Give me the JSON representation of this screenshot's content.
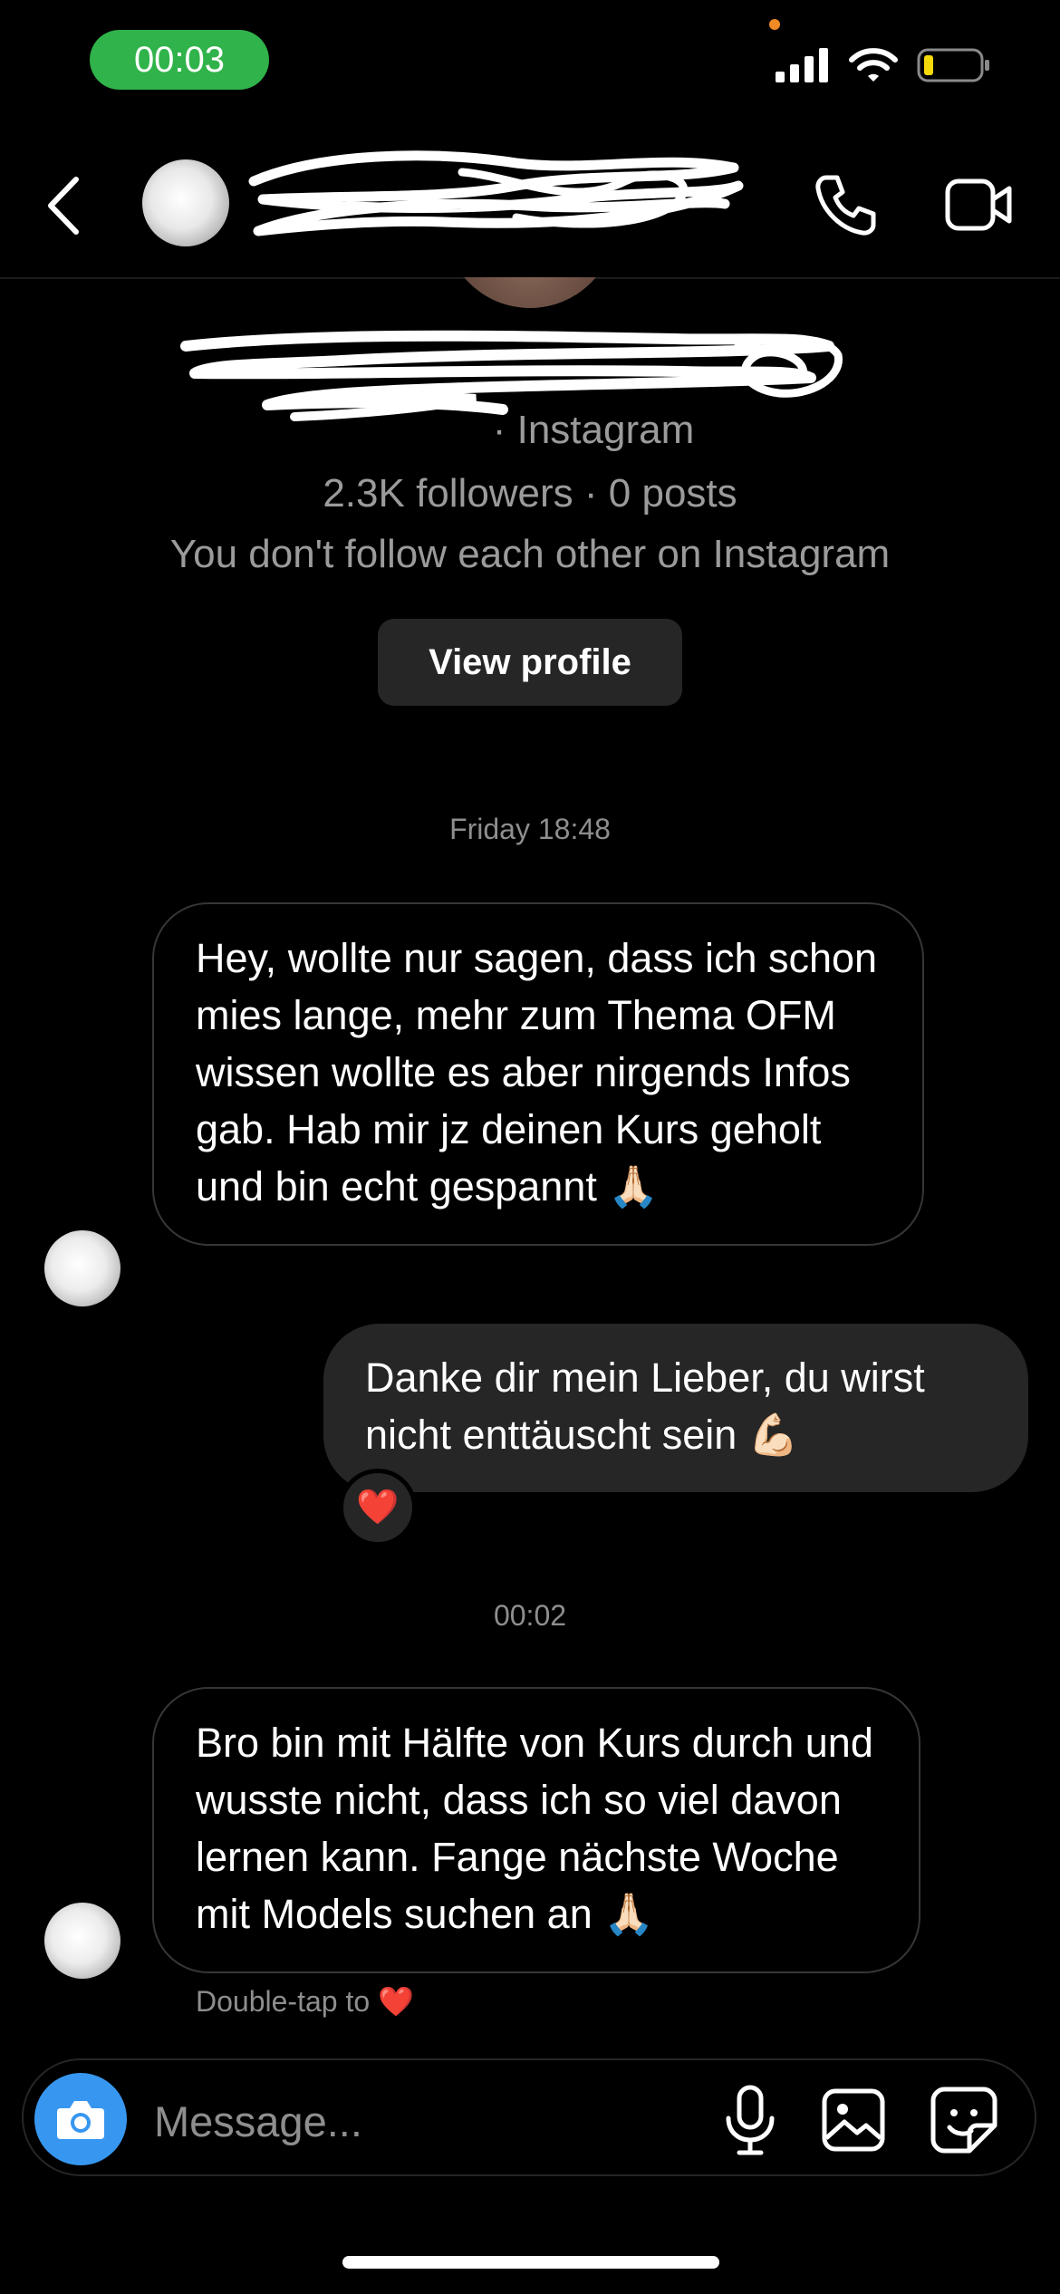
{
  "status_bar": {
    "time": "00:03",
    "icons": [
      "signal-icon",
      "wifi-icon",
      "battery-icon"
    ],
    "time_pill_color": "#30b34a",
    "battery_level_color": "#f5d90a"
  },
  "header": {
    "icons": [
      "back-icon",
      "phone-icon",
      "video-icon"
    ]
  },
  "profile": {
    "platform_suffix": "· Instagram",
    "stats": "2.3K followers · 0 posts",
    "relation": "You don't follow each other on Instagram",
    "view_profile_label": "View profile"
  },
  "thread": {
    "timestamp_1": "Friday 18:48",
    "msg_1": "Hey, wollte nur sagen, dass ich schon mies lange, mehr zum Thema OFM wissen wollte es aber nirgends Infos gab. Hab mir jz deinen Kurs geholt und bin echt gespannt 🙏🏻",
    "msg_2": "Danke dir mein Lieber, du wirst nicht enttäuscht sein 💪🏻",
    "reaction_2": "❤️",
    "timestamp_2": "00:02",
    "msg_3": "Bro bin mit Hälfte von Kurs durch und wusste nicht, dass ich so viel davon lernen kann. Fange nächste Woche mit Models suchen an 🙏🏻",
    "double_tap": "Double-tap to ❤️"
  },
  "composer": {
    "placeholder": "Message...",
    "icons": [
      "camera-icon",
      "microphone-icon",
      "image-icon",
      "sticker-icon"
    ],
    "camera_color": "#3797f0"
  }
}
